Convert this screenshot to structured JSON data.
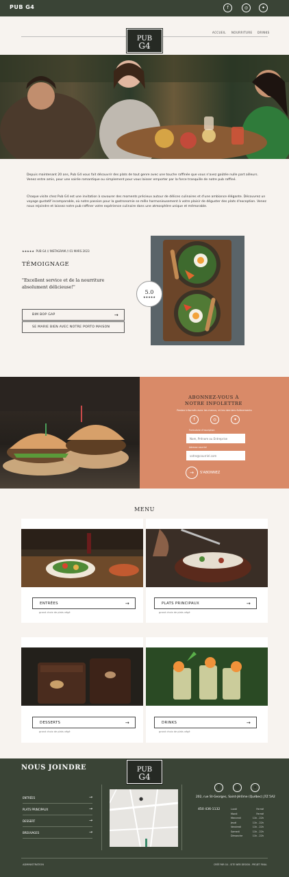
{
  "topbar": {
    "brand": "PUB G4"
  },
  "logo": {
    "line1": "PUB",
    "line2": "G4"
  },
  "nav": [
    "ACCUEIL",
    "NOURRITURE",
    "DRINKS"
  ],
  "intro": {
    "p1": "Depuis maintenant 20 ans, Pub G4 vous fait découvrir des plats de tout genre avec une touche raffinée que vous n'avez goûtée nulle part ailleurs. Venez entre amis, pour une soirée romantique ou simplement pour vous laisser emporter par la force tranquille de notre pub raffiné.",
    "p2": "Chaque visite chez Pub G4 est une invitation à savourer des moments précieux autour de délices culinaires et d'une ambiance élégante. Découvrez un voyage gustatif incomparable, où notre passion pour la gastronomie se mêle harmonieusement à votre plaisir de déguster des plats d'exception. Venez nous rejoindre et laissez notre pub raffiner votre expérience culinaire dans une atmosphère unique et mémorable."
  },
  "testimonial": {
    "stars": "★★★★★",
    "source": "PUB G4 // INSTAGRAM // 01 MARS 2023",
    "title": "TÉMOIGNAGE",
    "quote": "\"Excellent service et de la nourriture absolument délicieuse!\"",
    "btn1": "BIM BOP GAP",
    "btn2": "SE MARIE BIEN AVEC NOTRE PORTO MAISON",
    "rating": "5.0",
    "rating_stars": "★★★★★"
  },
  "newsletter": {
    "title1": "ABONNEZ-VOUS À",
    "title2": "NOTRE INFOLETTRE",
    "subtitle": "Restez informés avec les menus, et les derniers évènements",
    "form_label": "Formulaire d'inscription",
    "name_placeholder": "Nom, Prénom ou Entreprise",
    "addr_label": "Adresse courriel",
    "email_placeholder": "votre@courriel.com",
    "submit": "S'ABONNEZ"
  },
  "menu": {
    "title": "MENU",
    "cards": [
      {
        "label": "ENTRÉES",
        "sub": "grand choix de plats végé"
      },
      {
        "label": "PLATS PRINCIPAUX",
        "sub": "grand choix de plats végé"
      },
      {
        "label": "DESSERTS",
        "sub": "grand choix de plats végé"
      },
      {
        "label": "DRINKS",
        "sub": "grand choix de plats végé"
      }
    ]
  },
  "footer": {
    "title": "NOUS JOINDRE",
    "links": [
      "ENTRÉES",
      "PLATS PRINCIPAUX",
      "DESSERT",
      "BREUVAGES"
    ],
    "address": "202, rue St-Georges, Saint-Jérôme (Québec) J7Z 5A2",
    "phone": "450 436-1132",
    "hours": [
      [
        "Lundi",
        "Fermé"
      ],
      [
        "Mardi",
        "Fermé"
      ],
      [
        "Mercredi",
        "11h - 22h"
      ],
      [
        "Jeudi",
        "11h - 22h"
      ],
      [
        "Vendredi",
        "11h - 22h"
      ],
      [
        "Samedi",
        "11h - 22h"
      ],
      [
        "Dimanche",
        "11h - 22h"
      ]
    ],
    "admin": "ADMINISTRATION",
    "credit": "CRÉÉ PAR G4 - SITE WEB DESIGN - PROJET FINAL"
  },
  "colors": {
    "dark_green": "#3a4436",
    "orange": "#d98a68",
    "cream": "#f7f3ef"
  },
  "icons": [
    "facebook-icon",
    "instagram-icon",
    "twitter-icon",
    "arrow-right-icon",
    "map-pin-icon"
  ]
}
